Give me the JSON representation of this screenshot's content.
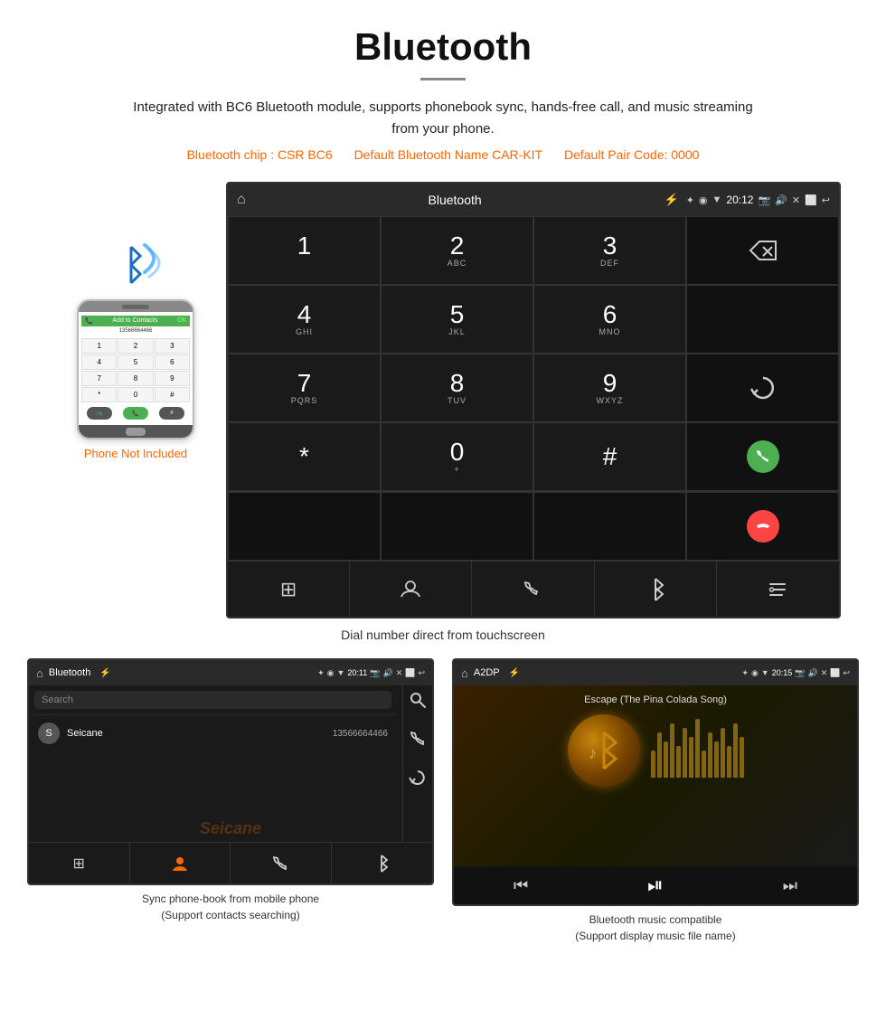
{
  "page": {
    "title": "Bluetooth",
    "divider": true
  },
  "description": {
    "main": "Integrated with BC6 Bluetooth module, supports phonebook sync, hands-free call, and music streaming from your phone.",
    "specs": [
      "Bluetooth chip : CSR BC6",
      "Default Bluetooth Name CAR-KIT",
      "Default Pair Code: 0000"
    ]
  },
  "phone_aside": {
    "label": "Phone Not Included"
  },
  "main_car_screen": {
    "statusbar": {
      "home_icon": "⌂",
      "title": "Bluetooth",
      "usb_icon": "⚡",
      "bt_icon": "✦",
      "location_icon": "◉",
      "signal_icon": "▼",
      "time": "20:12",
      "camera_icon": "📷",
      "volume_icon": "🔊",
      "close_icon": "✕",
      "window_icon": "⬜",
      "back_icon": "↩"
    },
    "dialpad": [
      {
        "num": "1",
        "sub": ""
      },
      {
        "num": "2",
        "sub": "ABC"
      },
      {
        "num": "3",
        "sub": "DEF"
      },
      {
        "action": "backspace"
      },
      {
        "num": "4",
        "sub": "GHI"
      },
      {
        "num": "5",
        "sub": "JKL"
      },
      {
        "num": "6",
        "sub": "MNO"
      },
      {
        "action": "empty"
      },
      {
        "num": "7",
        "sub": "PQRS"
      },
      {
        "num": "8",
        "sub": "TUV"
      },
      {
        "num": "9",
        "sub": "WXYZ"
      },
      {
        "action": "refresh"
      },
      {
        "num": "*",
        "sub": ""
      },
      {
        "num": "0",
        "sub": "+"
      },
      {
        "num": "#",
        "sub": ""
      },
      {
        "action": "call-green"
      },
      {
        "action": "call-red"
      }
    ],
    "bottom_nav": [
      "⊞",
      "👤",
      "📞",
      "✦",
      "✏"
    ]
  },
  "caption_main": "Dial number direct from touchscreen",
  "phonebook_screen": {
    "statusbar": {
      "title": "Bluetooth",
      "time": "20:11"
    },
    "search_placeholder": "Search",
    "contacts": [
      {
        "initial": "S",
        "name": "Seicane",
        "number": "13566664466"
      }
    ],
    "right_icons": [
      "🔍",
      "📞",
      "🔄"
    ],
    "bottom_nav": [
      "⊞",
      "👤",
      "📞",
      "✦"
    ]
  },
  "music_screen": {
    "statusbar": {
      "title": "A2DP",
      "time": "20:15"
    },
    "song_title": "Escape (The Pina Colada Song)",
    "album_icon": "🎵",
    "controls": [
      "⏮",
      "⏯",
      "⏭"
    ],
    "eq_bars": [
      30,
      50,
      40,
      60,
      35,
      55,
      45,
      65,
      30,
      50,
      40,
      55,
      35,
      60,
      45
    ]
  },
  "captions_bottom": {
    "left_line1": "Sync phone-book from mobile phone",
    "left_line2": "(Support contacts searching)",
    "right_line1": "Bluetooth music compatible",
    "right_line2": "(Support display music file name)"
  }
}
